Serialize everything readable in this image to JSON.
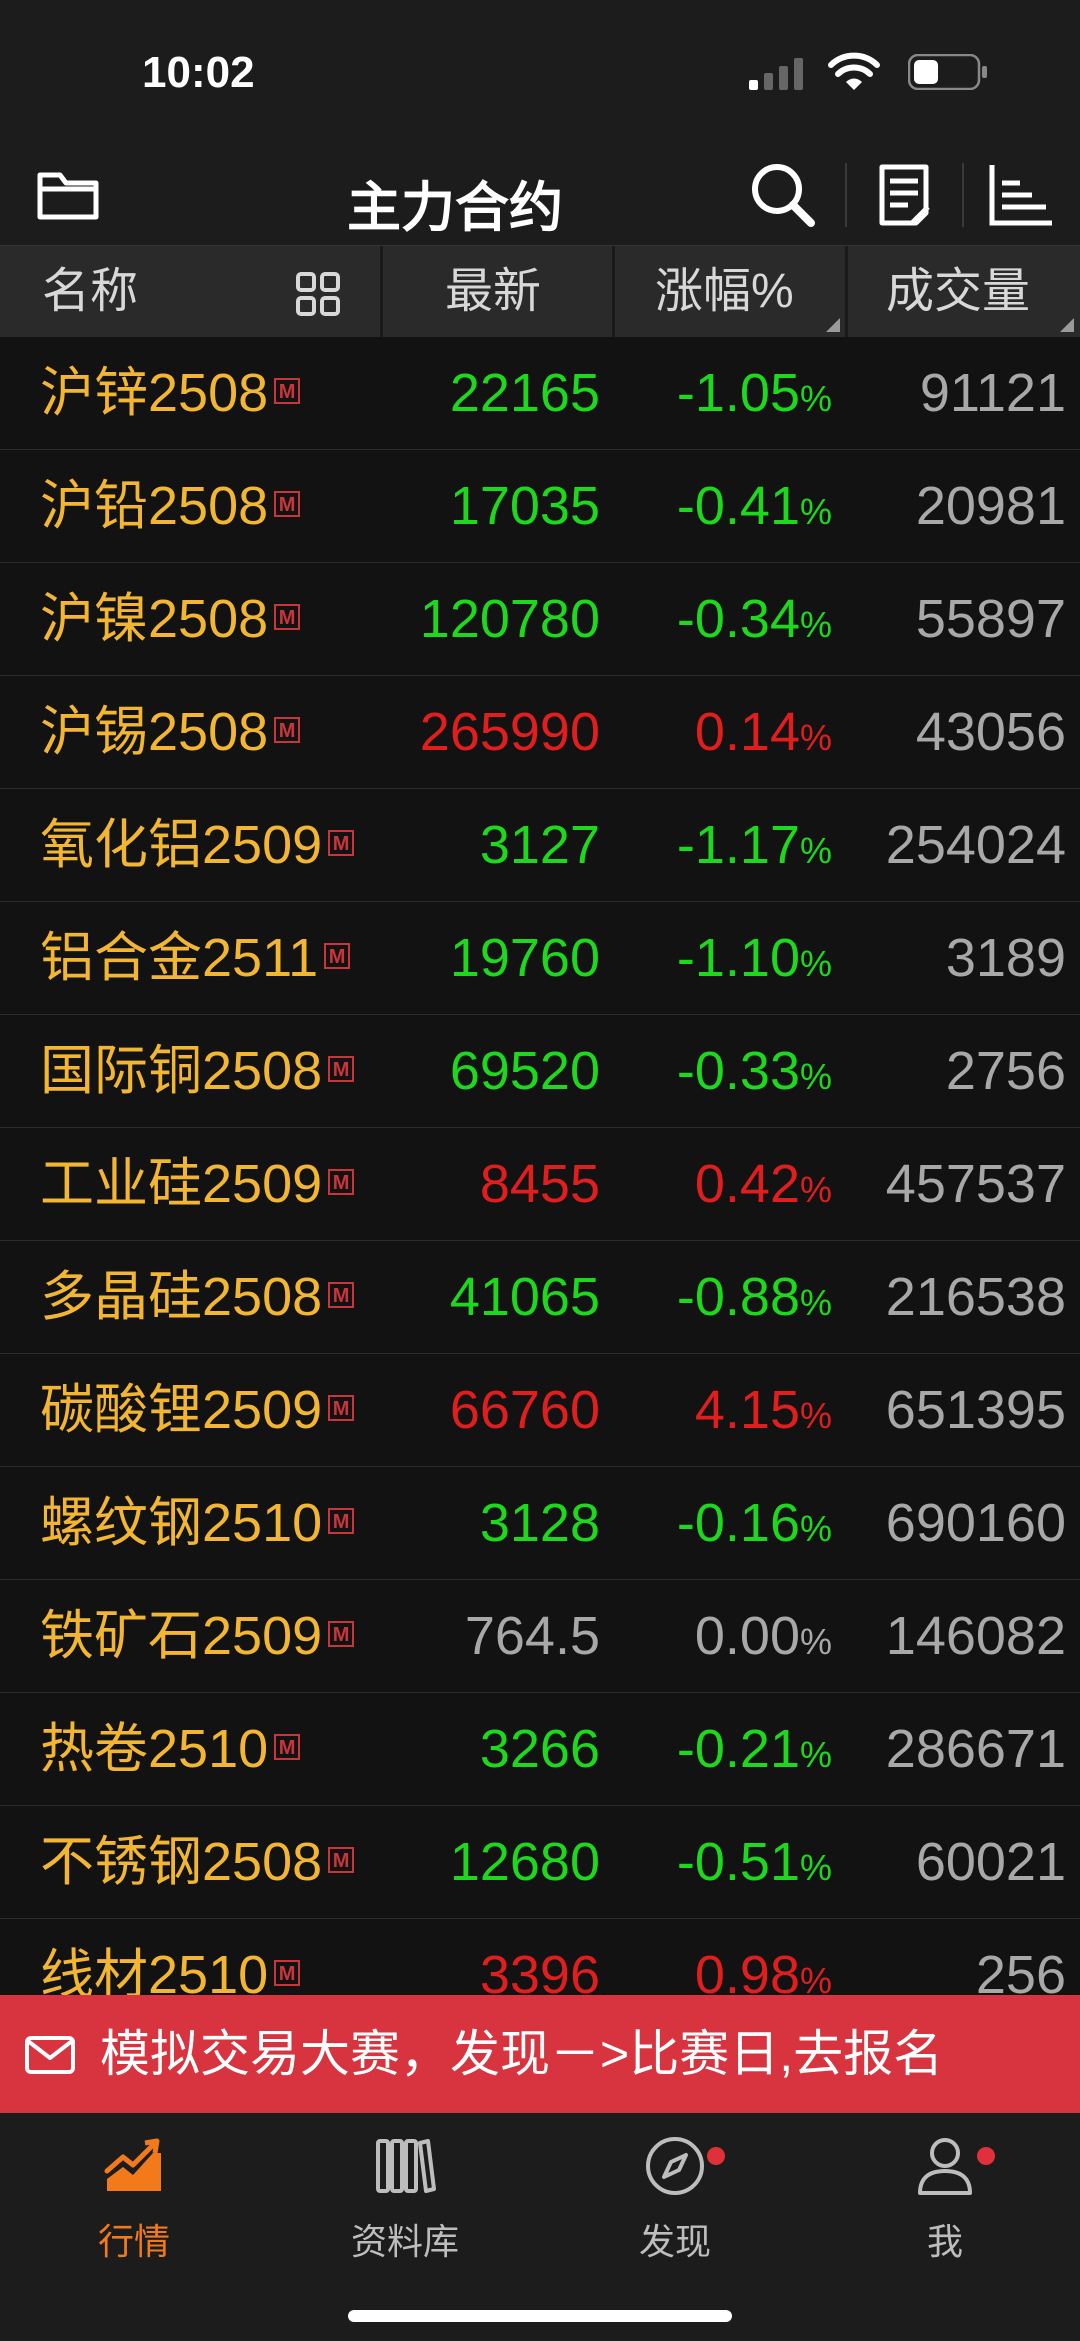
{
  "status": {
    "time": "10:02"
  },
  "nav": {
    "title": "主力合约"
  },
  "header": {
    "name": "名称",
    "latest": "最新",
    "change": "涨幅%",
    "volume": "成交量"
  },
  "badge": "M",
  "colors": {
    "up": "#e01e1e",
    "down": "#1ed81e",
    "flat": "#a8a8a8",
    "name": "#f2b632",
    "accent": "#f27a1a",
    "banner": "#d7343f"
  },
  "rows": [
    {
      "name": "沪锌2508",
      "price": "22165",
      "pct": "-1.05",
      "volume": "91121",
      "trend": "down"
    },
    {
      "name": "沪铅2508",
      "price": "17035",
      "pct": "-0.41",
      "volume": "20981",
      "trend": "down"
    },
    {
      "name": "沪镍2508",
      "price": "120780",
      "pct": "-0.34",
      "volume": "55897",
      "trend": "down"
    },
    {
      "name": "沪锡2508",
      "price": "265990",
      "pct": "0.14",
      "volume": "43056",
      "trend": "up"
    },
    {
      "name": "氧化铝2509",
      "price": "3127",
      "pct": "-1.17",
      "volume": "254024",
      "trend": "down"
    },
    {
      "name": "铝合金2511",
      "price": "19760",
      "pct": "-1.10",
      "volume": "3189",
      "trend": "down"
    },
    {
      "name": "国际铜2508",
      "price": "69520",
      "pct": "-0.33",
      "volume": "2756",
      "trend": "down"
    },
    {
      "name": "工业硅2509",
      "price": "8455",
      "pct": "0.42",
      "volume": "457537",
      "trend": "up"
    },
    {
      "name": "多晶硅2508",
      "price": "41065",
      "pct": "-0.88",
      "volume": "216538",
      "trend": "down"
    },
    {
      "name": "碳酸锂2509",
      "price": "66760",
      "pct": "4.15",
      "volume": "651395",
      "trend": "up"
    },
    {
      "name": "螺纹钢2510",
      "price": "3128",
      "pct": "-0.16",
      "volume": "690160",
      "trend": "down"
    },
    {
      "name": "铁矿石2509",
      "price": "764.5",
      "pct": "0.00",
      "volume": "146082",
      "trend": "flat"
    },
    {
      "name": "热卷2510",
      "price": "3266",
      "pct": "-0.21",
      "volume": "286671",
      "trend": "down"
    },
    {
      "name": "不锈钢2508",
      "price": "12680",
      "pct": "-0.51",
      "volume": "60021",
      "trend": "down"
    },
    {
      "name": "线材2510",
      "price": "3396",
      "pct": "0.98",
      "volume": "256",
      "trend": "up"
    }
  ],
  "banner": {
    "text": "模拟交易大赛，发现－>比赛日,去报名"
  },
  "tabs": [
    {
      "label": "行情",
      "icon": "market-chart-icon",
      "active": true,
      "dot": false
    },
    {
      "label": "资料库",
      "icon": "library-books-icon",
      "active": false,
      "dot": false
    },
    {
      "label": "发现",
      "icon": "compass-icon",
      "active": false,
      "dot": true
    },
    {
      "label": "我",
      "icon": "person-icon",
      "active": false,
      "dot": true
    }
  ]
}
